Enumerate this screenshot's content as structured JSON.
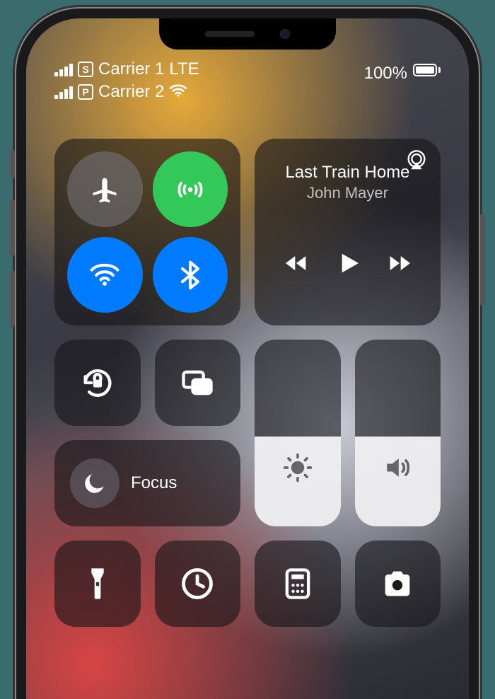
{
  "status": {
    "carrier1": {
      "name": "Carrier 1",
      "network": "LTE",
      "sim_badge": "S"
    },
    "carrier2": {
      "name": "Carrier 2",
      "sim_badge": "P"
    },
    "battery_percent": "100%"
  },
  "connectivity": {
    "airplane_mode": false,
    "cellular_data": true,
    "wifi": true,
    "bluetooth": true
  },
  "media": {
    "track_title": "Last Train Home",
    "artist": "John Mayer"
  },
  "focus": {
    "label": "Focus",
    "active": false
  },
  "brightness_percent": 48,
  "volume_percent": 48,
  "tiles": {
    "orientation_lock": "Orientation Lock",
    "screen_mirroring": "Screen Mirroring",
    "flashlight": "Flashlight",
    "timer": "Timer",
    "calculator": "Calculator",
    "camera": "Camera"
  }
}
